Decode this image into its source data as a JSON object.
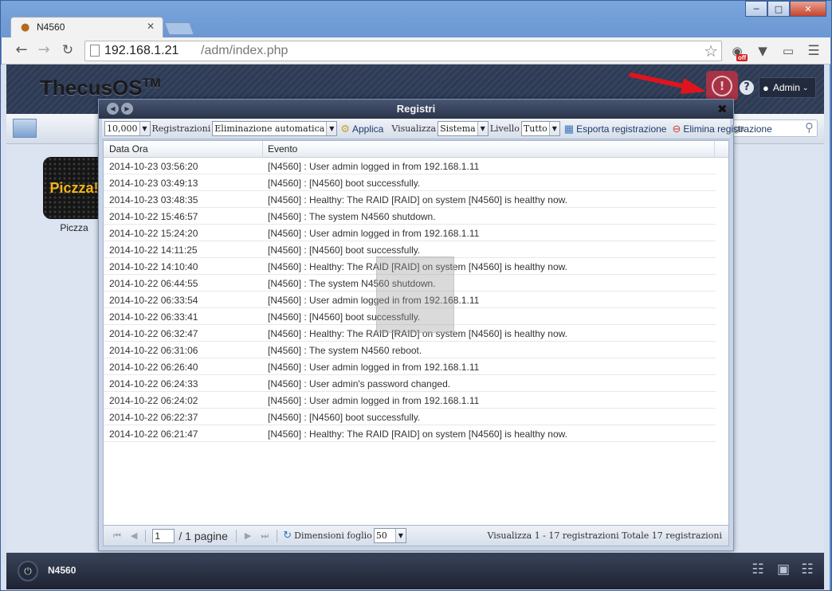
{
  "browser": {
    "tab_title": "N4560",
    "url_host": "192.168.1.21",
    "url_path": "/adm/index.php",
    "ext_badge": "off"
  },
  "header": {
    "logo_text": "ThecusOS",
    "logo_tm": "TM",
    "user_label": "Admin"
  },
  "desk_bar": {
    "search_text": "ga"
  },
  "desktop": {
    "app_tile_logo": "Piczza!",
    "app_tile_label": "Piczza"
  },
  "taskbar": {
    "hostname": "N4560"
  },
  "dialog": {
    "title": "Registri",
    "toolbar": {
      "count_value": "10,000",
      "registrazioni_label": "Registrazioni",
      "mode_value": "Eliminazione automatica",
      "apply_label": "Applica",
      "visualizza_label": "Visualizza",
      "source_value": "Sistema",
      "livello_label": "Livello",
      "level_value": "Tutto",
      "export_label": "Esporta registrazione",
      "delete_label": "Elimina registrazione"
    },
    "columns": {
      "date": "Data Ora",
      "event": "Evento"
    },
    "rows": [
      {
        "date": "2014-10-23 03:56:20",
        "event": "[N4560] : User admin logged in from 192.168.1.11"
      },
      {
        "date": "2014-10-23 03:49:13",
        "event": "[N4560] : [N4560] boot successfully."
      },
      {
        "date": "2014-10-23 03:48:35",
        "event": "[N4560] : Healthy: The RAID [RAID] on system [N4560] is healthy now."
      },
      {
        "date": "2014-10-22 15:46:57",
        "event": "[N4560] : The system N4560 shutdown."
      },
      {
        "date": "2014-10-22 15:24:20",
        "event": "[N4560] : User admin logged in from 192.168.1.11"
      },
      {
        "date": "2014-10-22 14:11:25",
        "event": "[N4560] : [N4560] boot successfully."
      },
      {
        "date": "2014-10-22 14:10:40",
        "event": "[N4560] : Healthy: The RAID [RAID] on system [N4560] is healthy now."
      },
      {
        "date": "2014-10-22 06:44:55",
        "event": "[N4560] : The system N4560 shutdown."
      },
      {
        "date": "2014-10-22 06:33:54",
        "event": "[N4560] : User admin logged in from 192.168.1.11"
      },
      {
        "date": "2014-10-22 06:33:41",
        "event": "[N4560] : [N4560] boot successfully."
      },
      {
        "date": "2014-10-22 06:32:47",
        "event": "[N4560] : Healthy: The RAID [RAID] on system [N4560] is healthy now."
      },
      {
        "date": "2014-10-22 06:31:06",
        "event": "[N4560] : The system N4560 reboot."
      },
      {
        "date": "2014-10-22 06:26:40",
        "event": "[N4560] : User admin logged in from 192.168.1.11"
      },
      {
        "date": "2014-10-22 06:24:33",
        "event": "[N4560] : User admin's password changed."
      },
      {
        "date": "2014-10-22 06:24:02",
        "event": "[N4560] : User admin logged in from 192.168.1.11"
      },
      {
        "date": "2014-10-22 06:22:37",
        "event": "[N4560] : [N4560] boot successfully."
      },
      {
        "date": "2014-10-22 06:21:47",
        "event": "[N4560] : Healthy: The RAID [RAID] on system [N4560] is healthy now."
      }
    ],
    "pager": {
      "page_value": "1",
      "page_total": "/ 1 pagine",
      "page_size_label": "Dimensioni foglio",
      "page_size_value": "50",
      "status": "Visualizza 1 - 17 registrazioni Totale 17 registrazioni"
    }
  },
  "colors": {
    "alert_accent": "#a83346",
    "header_bg": "#2d3a52",
    "arrow_red": "#e0141e"
  }
}
